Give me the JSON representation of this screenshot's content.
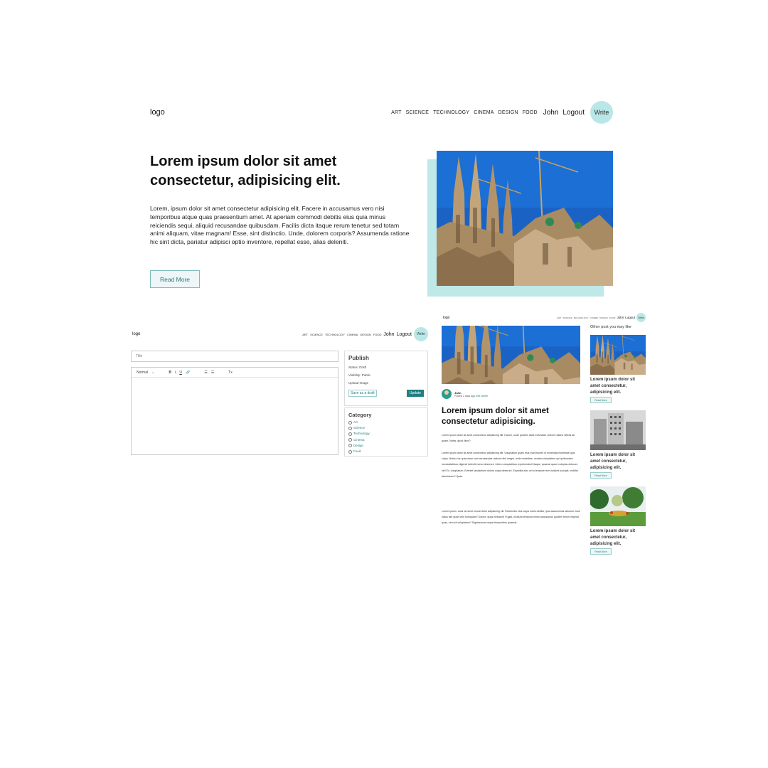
{
  "home": {
    "logo": "logo",
    "nav": {
      "categories": [
        "ART",
        "SCIENCE",
        "TECHNOLOGY",
        "CINEMA",
        "DESIGN",
        "FOOD"
      ],
      "user": "John",
      "logout": "Logout",
      "write": "Write"
    },
    "title": "Lorem ipsum dolor sit amet consectetur, adipisicing elit.",
    "description": "Lorem, ipsum dolor sit amet consectetur adipisicing elit. Facere in accusamus vero nisi temporibus atque quas praesentium amet. At aperiam commodi debitis eius quia minus reiciendis sequi, aliquid recusandae quibusdam. Facilis dicta itaque rerum tenetur sed totam animi aliquam, vitae magnam! Esse, sint distinctio. Unde, dolorem corporis? Assumenda ratione hic sint dicta, pariatur adipisci optio inventore, repellat esse, alias deleniti.",
    "read_more": "Read More"
  },
  "write_page": {
    "logo": "logo",
    "nav": {
      "categories": [
        "ART",
        "SCIENCE",
        "TECHNOLOGY",
        "CINEMA",
        "DESIGN",
        "FOOD"
      ],
      "user": "John",
      "logout": "Logout",
      "write": "Write"
    },
    "title_placeholder": "Title",
    "toolbar": {
      "format": "Normal",
      "bold": "B",
      "italic": "I",
      "underline": "U",
      "link": "🔗",
      "ordered_list": "☰",
      "bullet_list": "☰",
      "clean": "Tx"
    },
    "publish": {
      "heading": "Publish",
      "status": "Status: Draft",
      "visibility": "Visibility: Public",
      "upload": "Upload Image",
      "save_draft": "Save as a draft",
      "update": "Update"
    },
    "category": {
      "heading": "Category",
      "options": [
        "Art",
        "Science",
        "Technology",
        "Cinema",
        "Design",
        "Food"
      ]
    }
  },
  "post_page": {
    "logo": "logo",
    "nav": {
      "categories": [
        "ART",
        "SCIENCE",
        "TECHNOLOGY",
        "CINEMA",
        "DESIGN",
        "FOOD"
      ],
      "user": "John",
      "logout": "Logout",
      "write": "Write"
    },
    "author": {
      "name": "John",
      "posted": "Posted 2 days ago",
      "edit": "Edit Delete"
    },
    "title": "Lorem ipsum dolor sit amet consectetur adipisicing.",
    "paragraph_1": "Lorem ipsum dolor sit amet consectetur adipisicing elit. Harum, unde quidem dicta molestiae. Dolore ratione officiis ab quam. Nobis, quod illum?",
    "paragraph_2": "Lorem ipsum dolor sit amet consectetur adipisicing elit. Voluptatum quasi eius modi facere ut molestias molestiae quis culpa. Nobis eos quas esse sunt recusandae ratione nihil magni, unde molestiae, veniam voluptatem qui quibusdam necessitatibus eligendi deleniti nemo deserunt. Libero voluptatibus reprehenderit itaque, quaerat quam voluptas dolorum vel! Ex, voluptatum. Eveniet laudantium dolore culpa deserunt. Expedita eius vel a tempore rem incidunt suscipit, mollitia laboriosam? Quas.",
    "paragraph_3": "Lorem ipsum, dolor sit amet consectetur adipisicing elit. Reiciendis eius culpa nobis debitis, ipsa assumenda laborum esse natus sint quae velit numquam? Dolore, quasi nesciunt! Fugiat, incidunt tempora nemo accusamus quidem rerum impedit quas, vero sit voluptatum? Dignissimos neque temporibus quaerat.",
    "sidebar": {
      "heading": "Other post you may like",
      "cards": [
        {
          "title": "Lorem ipsum dolor sit amet consectetur, adipisicing elit.",
          "read_more": "Read More"
        },
        {
          "title": "Lorem ipsum dolor sit amet consectetur, adipisicing elit.",
          "read_more": "Read More"
        },
        {
          "title": "Lorem ipsum dolor sit amet consectetur, adipisicing elit.",
          "read_more": "Read More"
        }
      ]
    }
  },
  "colors": {
    "accent_teal": "#b9e7e7",
    "button_teal": "#1f7f7f",
    "link_teal": "#2a7a7a"
  }
}
